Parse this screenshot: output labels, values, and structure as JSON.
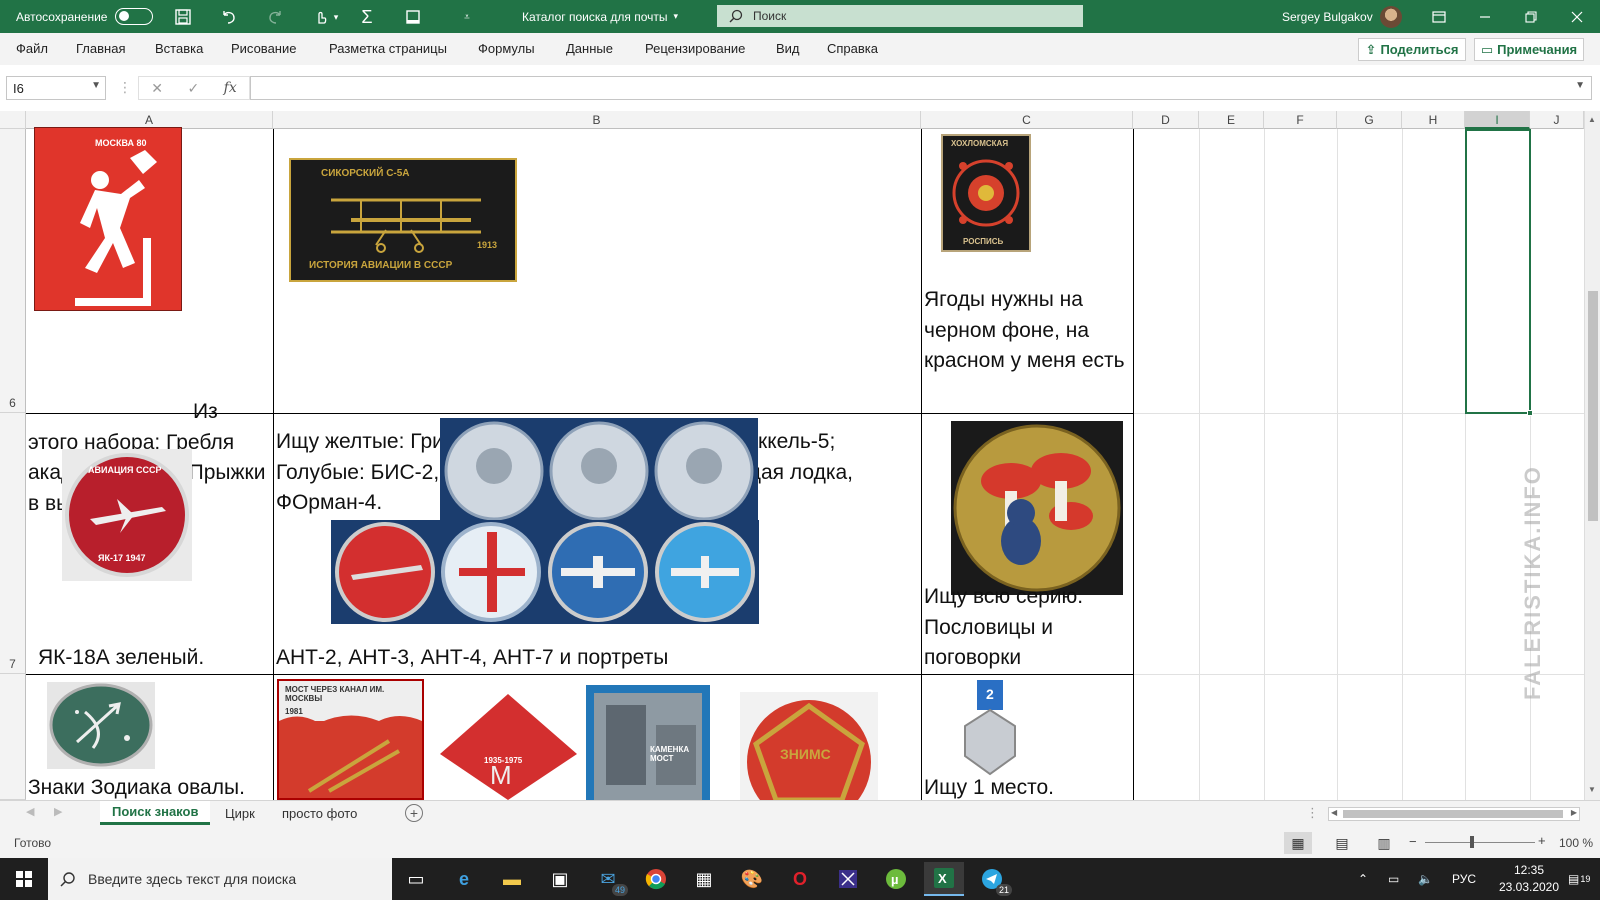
{
  "titlebar": {
    "autosave_label": "Автосохранение",
    "doc_title": "Каталог поиска для почты",
    "search_placeholder": "Поиск",
    "user_name": "Sergey Bulgakov"
  },
  "menu": {
    "items": [
      "Файл",
      "Главная",
      "Вставка",
      "Рисование",
      "Разметка страницы",
      "Формулы",
      "Данные",
      "Рецензирование",
      "Вид",
      "Справка"
    ],
    "share": "Поделиться",
    "comments": "Примечания"
  },
  "formula": {
    "name_box": "I6",
    "value": ""
  },
  "columns": [
    "A",
    "B",
    "C",
    "D",
    "E",
    "F",
    "G",
    "H",
    "I",
    "J"
  ],
  "active_column": "I",
  "rows": [
    "6",
    "7"
  ],
  "cells": {
    "a6": "Из этого набора:  Гребля академическая, Прыжки в высоту",
    "b6": "Ищу желтые:  Гризодубов 2, Карпека 3. Белые: Гаккель-5; Голубые: БИС-2, Гаккель-3, Косяненко-4, Летающая лодка, ФОрман-4.",
    "c6": "Ягоды нужны на черном фоне, на красном у меня есть",
    "a7": "ЯК-18А зеленый.",
    "b7": "АНТ-2, АНТ-3, АНТ-4, АНТ-7 и портреты",
    "c7": "Ищу всю серию. Пословицы и поговорки",
    "a8": "Знаки Зодиака овалы.",
    "c8": "Ищу 1 место."
  },
  "badges": {
    "moscow80": "МОСКВА 80",
    "sikorsky": "СИКОРСКИЙ С-5А",
    "sikorsky_year": "1913",
    "sikorsky_caption": "ИСТОРИЯ АВИАЦИИ В СССР",
    "khokhloma_top": "ХОХЛОМСКАЯ",
    "khokhloma_bottom": "РОСПИСЬ",
    "aviation": "АВИАЦИЯ СССР",
    "yak17": "ЯК-17 1947",
    "bridge": "МОСТ ЧЕРЕЗ КАНАЛ ИМ. МОСКВЫ",
    "bridge_year": "1981",
    "metro_years": "1935-1975",
    "kamenka": "КАМЕНКА МОСТ",
    "znimg": "ЗНИМС",
    "medal_number": "2"
  },
  "sheets": {
    "tabs": [
      "Поиск знаков",
      "Цирк",
      "просто фото"
    ],
    "active": "Поиск знаков"
  },
  "status": {
    "ready": "Готово",
    "zoom": "100 %"
  },
  "taskbar": {
    "search_placeholder": "Введите здесь текст для поиска",
    "mail_badge": "49",
    "telegram_badge": "21",
    "lang": "РУС",
    "time": "12:35",
    "date": "23.03.2020",
    "notif_count": "19"
  },
  "watermark": "FALERISTIKA.INFO",
  "colors": {
    "excel_green": "#217346",
    "menu_bg": "#f3f3f3",
    "taskbar_bg": "#1f1f1f"
  }
}
